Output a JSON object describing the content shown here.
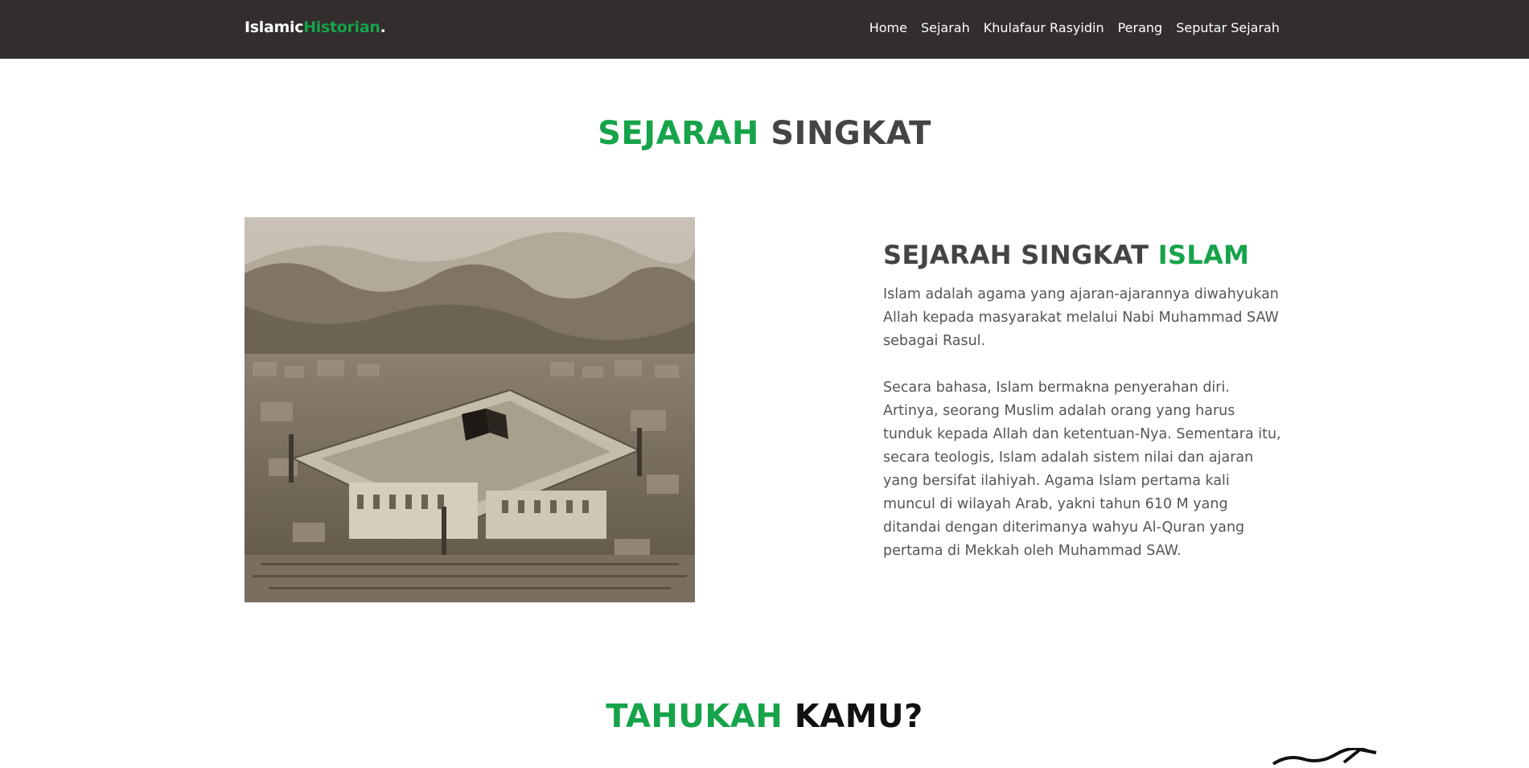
{
  "navbar": {
    "brand_part1": "Islamic",
    "brand_part2": "Historian",
    "brand_dot": ".",
    "links": [
      "Home",
      "Sejarah",
      "Khulafaur Rasyidin",
      "Perang",
      "Seputar Sejarah"
    ]
  },
  "section1": {
    "title_green": "SEJARAH",
    "title_dark": "SINGKAT",
    "heading_dark": "SEJARAH SINGKAT",
    "heading_green": "ISLAM",
    "paragraph1": "Islam adalah agama yang ajaran-ajarannya diwahyukan Allah kepada masyarakat melalui Nabi Muhammad SAW sebagai Rasul.",
    "paragraph2": "Secara bahasa, Islam bermakna penyerahan diri. Artinya, seorang Muslim adalah orang yang harus tunduk kepada Allah dan ketentuan-Nya. Sementara itu, secara teologis, Islam adalah sistem nilai dan ajaran yang bersifat ilahiyah. Agama Islam pertama kali muncul di wilayah Arab, yakni tahun 610 M yang ditandai dengan diterimanya wahyu Al-Quran yang pertama di Mekkah oleh Muhammad SAW."
  },
  "section2": {
    "title_green": "TAHUKAH",
    "title_dark": "KAMU?"
  },
  "colors": {
    "accent": "#16a34a",
    "navbar_bg": "#332d2d",
    "heading_text": "#444444"
  }
}
